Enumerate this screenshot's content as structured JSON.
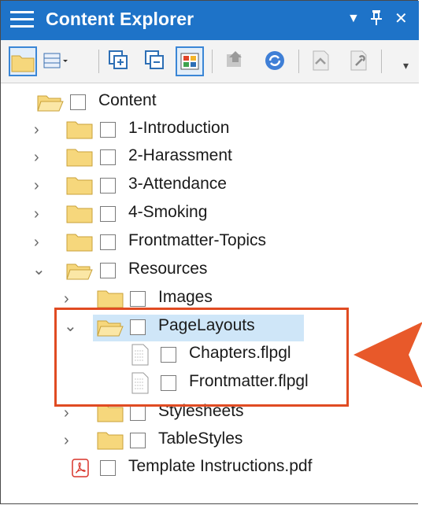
{
  "panel": {
    "title": "Content Explorer",
    "controls": {
      "dropdown": "▼",
      "pin": "ᴪ",
      "close": "✕"
    }
  },
  "toolbar": {
    "buttons": [
      {
        "name": "folder-view-button",
        "selected": true
      },
      {
        "name": "layout-dropdown-button",
        "selected": false
      },
      {
        "name": "expand-all-button",
        "selected": false
      },
      {
        "name": "collapse-all-button",
        "selected": false
      },
      {
        "name": "show-files-button",
        "selected": true
      },
      {
        "name": "bind-button",
        "selected": false
      },
      {
        "name": "sync-button",
        "selected": false
      },
      {
        "name": "check-in-button",
        "selected": false
      },
      {
        "name": "properties-button",
        "selected": false
      }
    ],
    "overflow": "▾"
  },
  "tree": {
    "root": "Content",
    "items": [
      {
        "label": "1-Introduction",
        "type": "folder",
        "expanded": false
      },
      {
        "label": "2-Harassment",
        "type": "folder",
        "expanded": false
      },
      {
        "label": "3-Attendance",
        "type": "folder",
        "expanded": false
      },
      {
        "label": "4-Smoking",
        "type": "folder",
        "expanded": false
      },
      {
        "label": "Frontmatter-Topics",
        "type": "folder",
        "expanded": false
      },
      {
        "label": "Resources",
        "type": "folder",
        "expanded": true
      },
      {
        "label": "Images",
        "type": "folder",
        "expanded": false
      },
      {
        "label": "PageLayouts",
        "type": "folder",
        "expanded": true,
        "selected": true
      },
      {
        "label": "Chapters.flpgl",
        "type": "file"
      },
      {
        "label": "Frontmatter.flpgl",
        "type": "file"
      },
      {
        "label": "Stylesheets",
        "type": "folder",
        "expanded": false
      },
      {
        "label": "TableStyles",
        "type": "folder",
        "expanded": false
      },
      {
        "label": "Template Instructions.pdf",
        "type": "pdf"
      }
    ]
  },
  "colors": {
    "accent": "#1e73c8",
    "callout": "#e04b22",
    "selection": "#cfe6f8"
  }
}
